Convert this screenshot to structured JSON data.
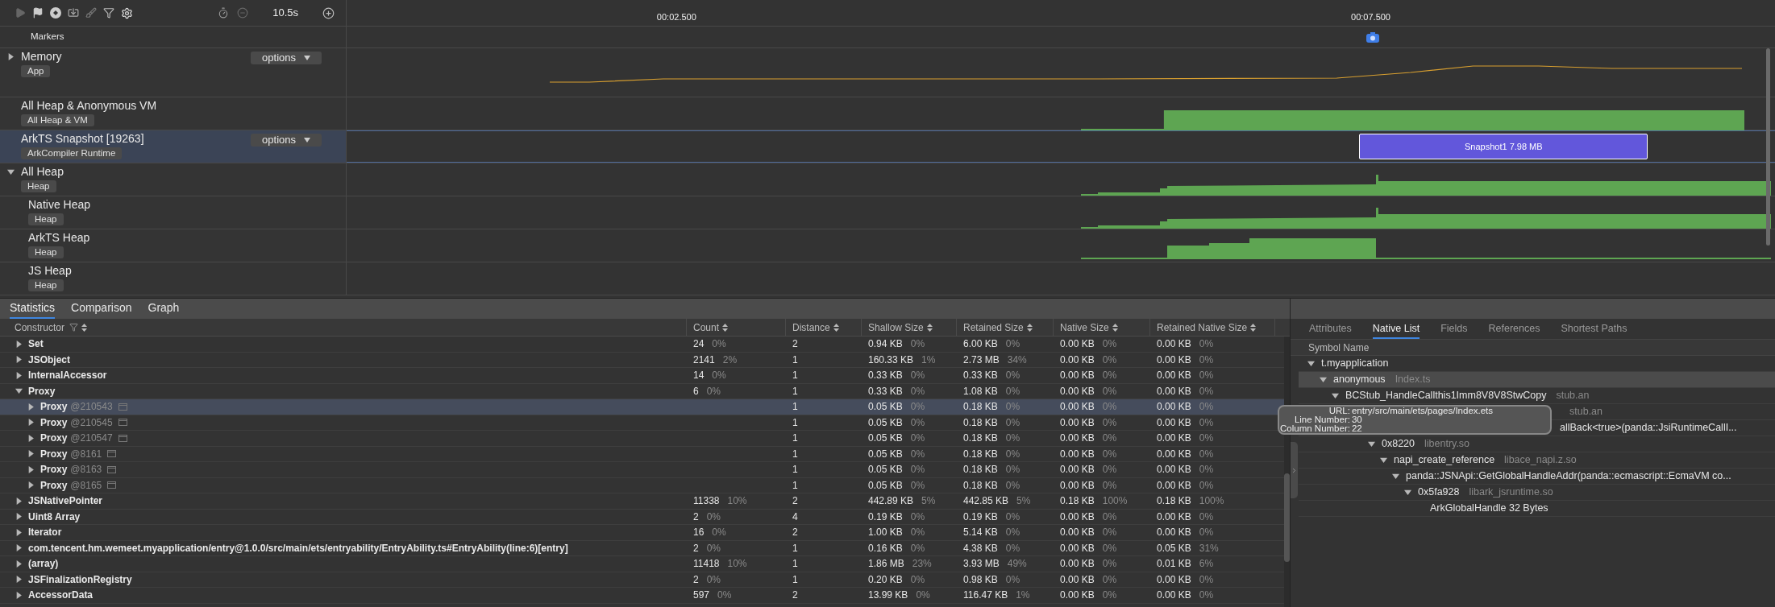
{
  "toolbar": {
    "duration": "10.5s"
  },
  "timeline": {
    "ticks": [
      "00:02.500",
      "00:07.500"
    ],
    "markers_label": "Markers"
  },
  "tracks": [
    {
      "name": "Memory",
      "tag": "App",
      "expanded": false,
      "options": "options",
      "selected": false,
      "kind": "line"
    },
    {
      "name": "All Heap & Anonymous VM",
      "tag": "All Heap & VM",
      "selected": false,
      "kind": "block"
    },
    {
      "name": "ArkTS Snapshot [19263]",
      "tag": "ArkCompiler Runtime",
      "options": "options",
      "selected": true,
      "kind": "snapshot",
      "snapshot": "Snapshot1 7.98 MB"
    },
    {
      "name": "All Heap",
      "tag": "Heap",
      "expanded": true,
      "selected": false,
      "kind": "ramp",
      "children": [
        {
          "name": "Native Heap",
          "tag": "Heap",
          "selected": false,
          "kind": "ramp"
        },
        {
          "name": "ArkTS Heap",
          "tag": "Heap",
          "selected": false,
          "kind": "bump"
        },
        {
          "name": "JS Heap",
          "tag": "Heap",
          "selected": false
        }
      ]
    }
  ],
  "statistics": {
    "tabs": [
      {
        "label": "Statistics",
        "selected": true
      },
      {
        "label": "Comparison",
        "selected": false
      },
      {
        "label": "Graph",
        "selected": false
      }
    ],
    "columns": [
      "Constructor",
      "Count",
      "Distance",
      "Shallow Size",
      "Retained Size",
      "Native Size",
      "Retained Native Size"
    ],
    "rows": [
      {
        "name": "Set",
        "expanded": false,
        "selected": false,
        "count": [
          "24",
          "0%"
        ],
        "distance": "2",
        "shallow_size": [
          "0.94 KB",
          "0%"
        ],
        "retained_size": [
          "6.00 KB",
          "0%"
        ],
        "native_size": [
          "0.00 KB",
          "0%"
        ],
        "retained_native_size": [
          "0.00 KB",
          "0%"
        ]
      },
      {
        "name": "JSObject",
        "expanded": false,
        "selected": false,
        "count": [
          "2141",
          "2%"
        ],
        "distance": "1",
        "shallow_size": [
          "160.33 KB",
          "1%"
        ],
        "retained_size": [
          "2.73 MB",
          "34%"
        ],
        "native_size": [
          "0.00 KB",
          "0%"
        ],
        "retained_native_size": [
          "0.00 KB",
          "0%"
        ]
      },
      {
        "name": "InternalAccessor",
        "expanded": false,
        "selected": false,
        "count": [
          "14",
          "0%"
        ],
        "distance": "1",
        "shallow_size": [
          "0.33 KB",
          "0%"
        ],
        "retained_size": [
          "0.33 KB",
          "0%"
        ],
        "native_size": [
          "0.00 KB",
          "0%"
        ],
        "retained_native_size": [
          "0.00 KB",
          "0%"
        ]
      },
      {
        "name": "Proxy",
        "expanded": true,
        "selected": false,
        "count": [
          "6",
          "0%"
        ],
        "distance": "1",
        "shallow_size": [
          "0.33 KB",
          "0%"
        ],
        "retained_size": [
          "1.08 KB",
          "0%"
        ],
        "native_size": [
          "0.00 KB",
          "0%"
        ],
        "retained_native_size": [
          "0.00 KB",
          "0%"
        ],
        "children": [
          {
            "name": "Proxy",
            "id": "@210543",
            "expanded": false,
            "selected": true,
            "distance": "1",
            "shallow_size": [
              "0.05 KB",
              "0%"
            ],
            "retained_size": [
              "0.18 KB",
              "0%"
            ],
            "native_size": [
              "0.00 KB",
              "0%"
            ],
            "retained_native_size": [
              "0.00 KB",
              "0%"
            ]
          },
          {
            "name": "Proxy",
            "id": "@210545",
            "expanded": false,
            "selected": false,
            "distance": "1",
            "shallow_size": [
              "0.05 KB",
              "0%"
            ],
            "retained_size": [
              "0.18 KB",
              "0%"
            ],
            "native_size": [
              "0.00 KB",
              "0%"
            ],
            "retained_native_size": [
              "0.00 KB",
              "0%"
            ]
          },
          {
            "name": "Proxy",
            "id": "@210547",
            "expanded": false,
            "selected": false,
            "distance": "1",
            "shallow_size": [
              "0.05 KB",
              "0%"
            ],
            "retained_size": [
              "0.18 KB",
              "0%"
            ],
            "native_size": [
              "0.00 KB",
              "0%"
            ],
            "retained_native_size": [
              "0.00 KB",
              "0%"
            ]
          },
          {
            "name": "Proxy",
            "id": "@8161",
            "expanded": false,
            "selected": false,
            "distance": "1",
            "shallow_size": [
              "0.05 KB",
              "0%"
            ],
            "retained_size": [
              "0.18 KB",
              "0%"
            ],
            "native_size": [
              "0.00 KB",
              "0%"
            ],
            "retained_native_size": [
              "0.00 KB",
              "0%"
            ]
          },
          {
            "name": "Proxy",
            "id": "@8163",
            "expanded": false,
            "selected": false,
            "distance": "1",
            "shallow_size": [
              "0.05 KB",
              "0%"
            ],
            "retained_size": [
              "0.18 KB",
              "0%"
            ],
            "native_size": [
              "0.00 KB",
              "0%"
            ],
            "retained_native_size": [
              "0.00 KB",
              "0%"
            ]
          },
          {
            "name": "Proxy",
            "id": "@8165",
            "expanded": false,
            "selected": false,
            "distance": "1",
            "shallow_size": [
              "0.05 KB",
              "0%"
            ],
            "retained_size": [
              "0.18 KB",
              "0%"
            ],
            "native_size": [
              "0.00 KB",
              "0%"
            ],
            "retained_native_size": [
              "0.00 KB",
              "0%"
            ]
          }
        ]
      },
      {
        "name": "JSNativePointer",
        "expanded": false,
        "selected": false,
        "count": [
          "11338",
          "10%"
        ],
        "distance": "2",
        "shallow_size": [
          "442.89 KB",
          "5%"
        ],
        "retained_size": [
          "442.85 KB",
          "5%"
        ],
        "native_size": [
          "0.18 KB",
          "100%"
        ],
        "retained_native_size": [
          "0.18 KB",
          "100%"
        ]
      },
      {
        "name": "Uint8 Array",
        "expanded": false,
        "selected": false,
        "count": [
          "2",
          "0%"
        ],
        "distance": "4",
        "shallow_size": [
          "0.19 KB",
          "0%"
        ],
        "retained_size": [
          "0.19 KB",
          "0%"
        ],
        "native_size": [
          "0.00 KB",
          "0%"
        ],
        "retained_native_size": [
          "0.00 KB",
          "0%"
        ]
      },
      {
        "name": "Iterator",
        "expanded": false,
        "selected": false,
        "count": [
          "16",
          "0%"
        ],
        "distance": "2",
        "shallow_size": [
          "1.00 KB",
          "0%"
        ],
        "retained_size": [
          "5.14 KB",
          "0%"
        ],
        "native_size": [
          "0.00 KB",
          "0%"
        ],
        "retained_native_size": [
          "0.00 KB",
          "0%"
        ]
      },
      {
        "name": "com.tencent.hm.wemeet.myapplication/entry@1.0.0/src/main/ets/entryability/EntryAbility.ts#EntryAbility(line:6)[entry]",
        "expanded": false,
        "selected": false,
        "count": [
          "2",
          "0%"
        ],
        "distance": "1",
        "shallow_size": [
          "0.16 KB",
          "0%"
        ],
        "retained_size": [
          "4.38 KB",
          "0%"
        ],
        "native_size": [
          "0.00 KB",
          "0%"
        ],
        "retained_native_size": [
          "0.05 KB",
          "31%"
        ]
      },
      {
        "name": "(array)",
        "expanded": false,
        "selected": false,
        "count": [
          "11418",
          "10%"
        ],
        "distance": "1",
        "shallow_size": [
          "1.86 MB",
          "23%"
        ],
        "retained_size": [
          "3.93 MB",
          "49%"
        ],
        "native_size": [
          "0.00 KB",
          "0%"
        ],
        "retained_native_size": [
          "0.01 KB",
          "6%"
        ]
      },
      {
        "name": "JSFinalizationRegistry",
        "expanded": false,
        "selected": false,
        "count": [
          "2",
          "0%"
        ],
        "distance": "1",
        "shallow_size": [
          "0.20 KB",
          "0%"
        ],
        "retained_size": [
          "0.98 KB",
          "0%"
        ],
        "native_size": [
          "0.00 KB",
          "0%"
        ],
        "retained_native_size": [
          "0.00 KB",
          "0%"
        ]
      },
      {
        "name": "AccessorData",
        "expanded": false,
        "selected": false,
        "count": [
          "597",
          "0%"
        ],
        "distance": "2",
        "shallow_size": [
          "13.99 KB",
          "0%"
        ],
        "retained_size": [
          "116.47 KB",
          "1%"
        ],
        "native_size": [
          "0.00 KB",
          "0%"
        ],
        "retained_native_size": [
          "0.00 KB",
          "0%"
        ]
      }
    ]
  },
  "details": {
    "tabs": [
      {
        "label": "Attributes",
        "selected": false
      },
      {
        "label": "Native List",
        "selected": true
      },
      {
        "label": "Fields",
        "selected": false
      },
      {
        "label": "References",
        "selected": false
      },
      {
        "label": "Shortest Paths",
        "selected": false
      }
    ],
    "header": "Symbol Name",
    "tree": [
      {
        "name": "t.myapplication",
        "kind": "row",
        "expanded": true,
        "selected": false,
        "children": [
          {
            "name": "anonymous",
            "lib": "Index.ts",
            "kind": "row",
            "expanded": true,
            "selected": true,
            "children": [
              {
                "name": "BCStub_HandleCallthis1Imm8V8V8StwCopy",
                "lib": "stub.an",
                "kind": "row",
                "expanded": true,
                "selected": false,
                "children": [
                  {
                    "lib": "stub.an",
                    "kind": "covered",
                    "selected": false,
                    "children": [
                      {
                        "name": "allBack<true>(panda::JsiRuntimeCallI...",
                        "kind": "covered",
                        "selected": false,
                        "children": [
                          {
                            "name": "0x8220",
                            "lib": "libentry.so",
                            "kind": "row",
                            "expanded": true,
                            "selected": false,
                            "children": [
                              {
                                "name": "napi_create_reference",
                                "lib": "libace_napi.z.so",
                                "kind": "row",
                                "expanded": true,
                                "selected": false,
                                "children": [
                                  {
                                    "name": "panda::JSNApi::GetGlobalHandleAddr(panda::ecmascript::EcmaVM co...",
                                    "kind": "row",
                                    "expanded": true,
                                    "selected": false,
                                    "children": [
                                      {
                                        "name": "0x5fa928",
                                        "lib": "libark_jsruntime.so",
                                        "kind": "row",
                                        "expanded": true,
                                        "selected": false,
                                        "children": [
                                          {
                                            "name": "ArkGlobalHandle 32 Bytes",
                                            "kind": "row",
                                            "selected": false
                                          }
                                        ]
                                      }
                                    ]
                                  }
                                ]
                              }
                            ]
                          }
                        ]
                      }
                    ]
                  }
                ]
              }
            ]
          }
        ]
      }
    ],
    "tooltip": [
      {
        "label": "URL:",
        "value": "entry/src/main/ets/pages/Index.ets"
      },
      {
        "label": "Line Number:",
        "value": "30"
      },
      {
        "label": "Column Number:",
        "value": "22"
      }
    ]
  }
}
